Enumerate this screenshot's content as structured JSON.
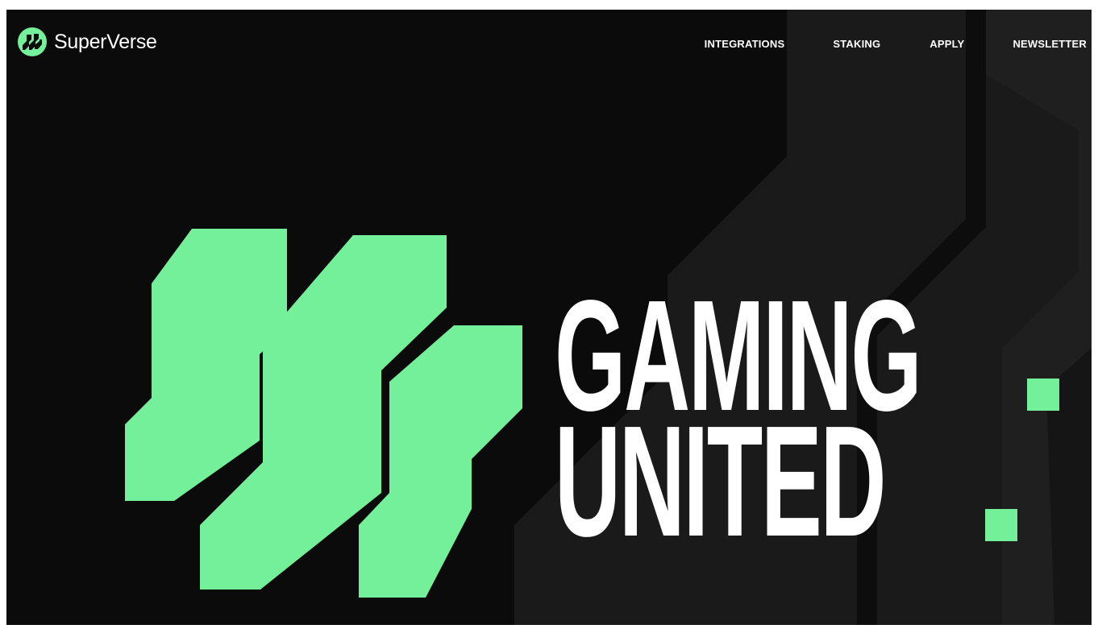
{
  "brand": {
    "name": "SuperVerse",
    "accent_color": "#74f09a",
    "background_color": "#0b0b0b",
    "logo_icon": "superverse-s-mark-icon"
  },
  "nav": {
    "items": [
      {
        "label": "INTEGRATIONS"
      },
      {
        "label": "STAKING"
      },
      {
        "label": "APPLY"
      },
      {
        "label": "NEWSLETTER"
      }
    ]
  },
  "hero": {
    "line1": "GAMING",
    "line2": "UNITED",
    "graphic": "superverse-large-s-mark"
  }
}
